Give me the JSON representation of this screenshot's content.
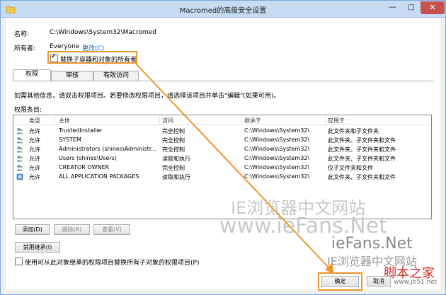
{
  "window": {
    "title": "Macromed的高级安全设置"
  },
  "header": {
    "name_label": "名称:",
    "name_value": "C:\\Windows\\System32\\Macromed",
    "owner_label": "所有者:",
    "owner_value": "Everyone",
    "owner_change_link": "更改(C)",
    "replace_owner_checkbox": {
      "label": "替换子容器和对象的所有者",
      "checked": true
    }
  },
  "tabs": [
    {
      "label": "权限",
      "active": true
    },
    {
      "label": "审核",
      "active": false
    },
    {
      "label": "有效访问",
      "active": false
    }
  ],
  "info_text": "如需其他信息，请双击权限项目。若要修改权限项目，请选择该项目并单击\"编辑\"(如果可用)。",
  "permissions_label": "权限条目:",
  "table": {
    "columns": [
      "类型",
      "主体",
      "访问",
      "继承于",
      "应用于"
    ],
    "rows": [
      {
        "type": "允许",
        "principal": "TrustedInstaller",
        "access": "完全控制",
        "inherited": "C:\\Windows\\System32\\",
        "applies": "此文件夹和子文件夹"
      },
      {
        "type": "允许",
        "principal": "SYSTEM",
        "access": "完全控制",
        "inherited": "C:\\Windows\\System32\\",
        "applies": "此文件夹、子文件夹和文件"
      },
      {
        "type": "允许",
        "principal": "Administrators (shines\\Administr...",
        "access": "完全控制",
        "inherited": "C:\\Windows\\System32\\",
        "applies": "此文件夹、子文件夹和文件"
      },
      {
        "type": "允许",
        "principal": "Users (shines\\Users)",
        "access": "读取和执行",
        "inherited": "C:\\Windows\\System32\\",
        "applies": "此文件夹、子文件夹和文件"
      },
      {
        "type": "允许",
        "principal": "CREATOR OWNER",
        "access": "完全控制",
        "inherited": "C:\\Windows\\System32\\",
        "applies": "仅子文件夹和文件"
      },
      {
        "type": "允许",
        "principal": "ALL APPLICATION PACKAGES",
        "access": "读取和执行",
        "inherited": "C:\\Windows\\System32\\",
        "applies": "此文件夹、子文件夹和文件"
      }
    ]
  },
  "buttons": {
    "add": "添加(D)",
    "remove": "删除(R)",
    "view": "查看(V)",
    "disable_inheritance": "禁用继承(I)",
    "ok": "确定",
    "cancel": "取消"
  },
  "replace_child_checkbox": {
    "label": "使用可从此对象继承的权限项目替换所有子对象的权限项目(P)",
    "checked": false
  },
  "watermarks": [
    "IE浏览器中文网站",
    "www.ieFans.Net",
    "ieFans.Net",
    "IE浏览器中文网站",
    "脚本之家",
    "www.jb51.net"
  ],
  "colors": {
    "highlight": "#f0962a",
    "title_bar": "#c7dcf3",
    "close_button": "#c75050",
    "link": "#1a5fb4"
  }
}
